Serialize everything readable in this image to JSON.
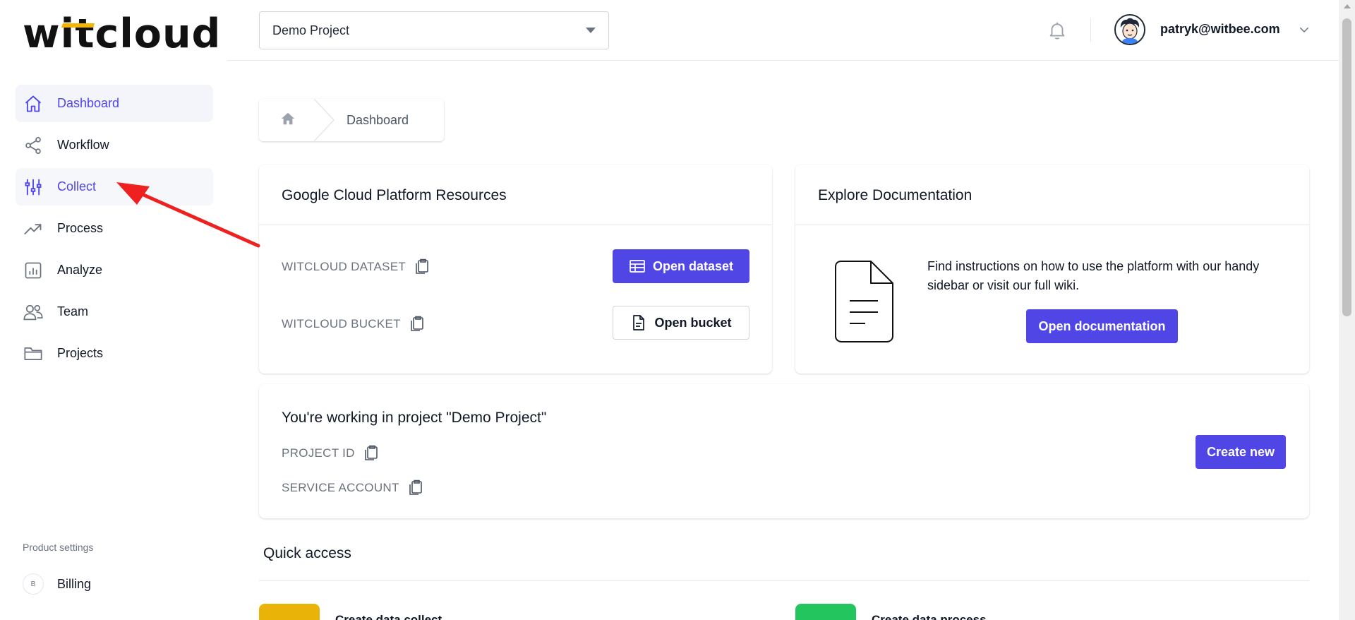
{
  "app": {
    "logo_prefix": "w",
    "logo_accent": "it",
    "logo_suffix": "cloud"
  },
  "sidebar": {
    "items": [
      {
        "label": "Dashboard",
        "icon": "home-icon",
        "state": "active"
      },
      {
        "label": "Workflow",
        "icon": "share-icon"
      },
      {
        "label": "Collect",
        "icon": "sliders-icon",
        "state": "highlighted"
      },
      {
        "label": "Process",
        "icon": "trending-up-icon"
      },
      {
        "label": "Analyze",
        "icon": "bar-chart-icon"
      },
      {
        "label": "Team",
        "icon": "users-icon"
      },
      {
        "label": "Projects",
        "icon": "folder-icon"
      }
    ],
    "settings_title": "Product settings",
    "billing_badge": "B",
    "billing_label": "Billing"
  },
  "header": {
    "project_select_value": "Demo Project",
    "user_email": "patryk@witbee.com"
  },
  "breadcrumb": {
    "current": "Dashboard"
  },
  "gcp_card": {
    "title": "Google Cloud Platform Resources",
    "dataset_label": "WITCLOUD DATASET",
    "bucket_label": "WITCLOUD BUCKET",
    "open_dataset": "Open dataset",
    "open_bucket": "Open bucket"
  },
  "docs_card": {
    "title": "Explore Documentation",
    "text": "Find instructions on how to use the platform with our handy sidebar or visit our full wiki.",
    "button": "Open documentation"
  },
  "project_card": {
    "title": "You're working in project \"Demo Project\"",
    "project_id_label": "PROJECT ID",
    "service_account_label": "SERVICE ACCOUNT",
    "create_button": "Create new"
  },
  "quick_access": {
    "title": "Quick access",
    "items": [
      {
        "label": "Create data collect",
        "color": "#eab308"
      },
      {
        "label": "Create data process",
        "color": "#22c55e"
      }
    ]
  },
  "colors": {
    "primary": "#4f46e5",
    "annotation": "#ef2020"
  }
}
